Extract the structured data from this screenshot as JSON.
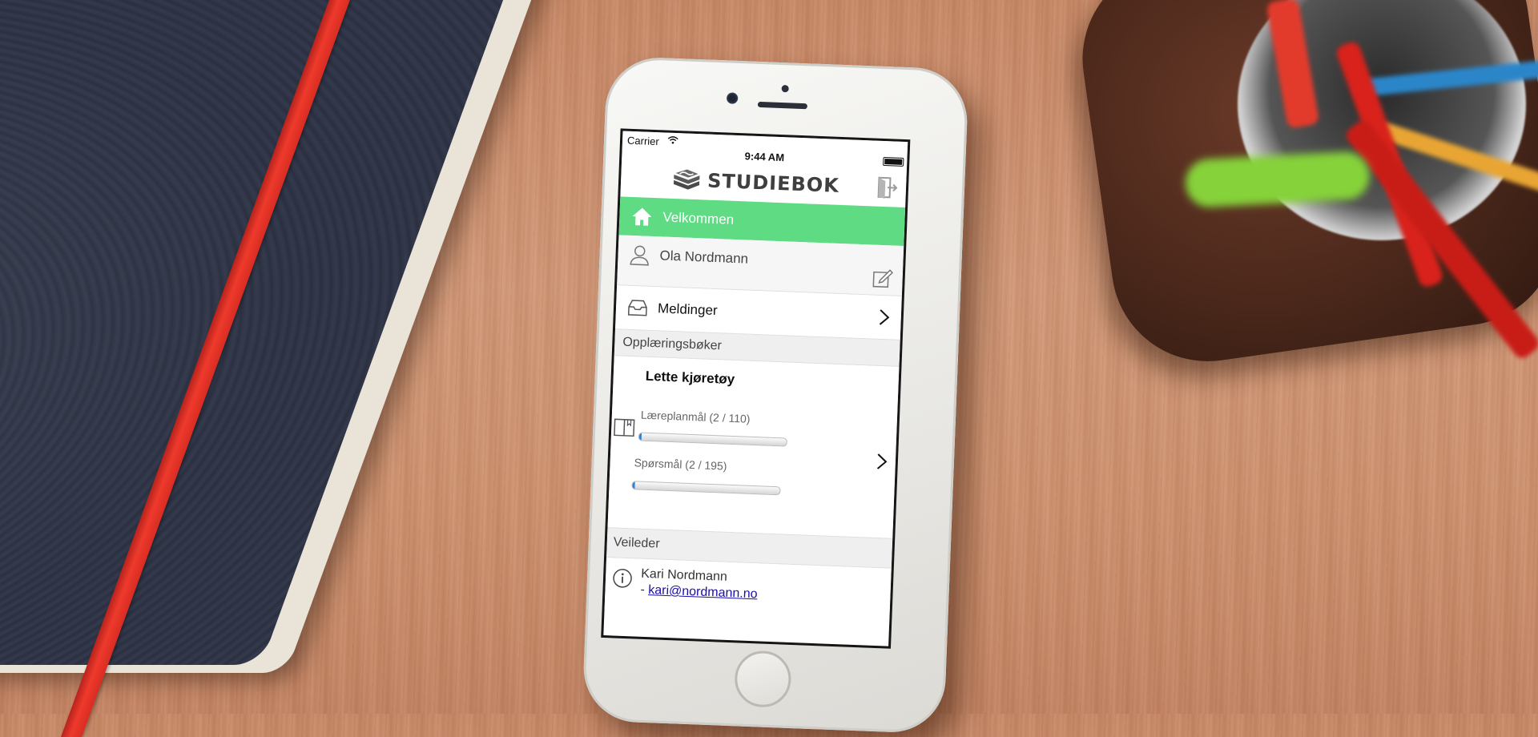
{
  "status_bar": {
    "carrier": "Carrier",
    "time": "9:44 AM"
  },
  "header": {
    "app_name": "STUDIEBOK"
  },
  "menu": {
    "welcome_label": "Velkommen",
    "user_name": "Ola Nordmann",
    "messages_label": "Meldinger"
  },
  "training_books": {
    "section_title": "Opplæringsbøker",
    "book": {
      "title": "Lette kjøretøy",
      "curriculum_label": "Læreplanmål (2 / 110)",
      "curriculum_progress": 0.018,
      "questions_label": "Spørsmål (2 / 195)",
      "questions_progress": 0.01
    }
  },
  "mentor": {
    "section_title": "Veileder",
    "name": "Kari Nordmann",
    "dash": "-",
    "email": "kari@nordmann.no"
  },
  "colors": {
    "accent_green": "#5fdb84",
    "progress_blue": "#2f7fd6",
    "link_blue": "#1a0dab"
  }
}
